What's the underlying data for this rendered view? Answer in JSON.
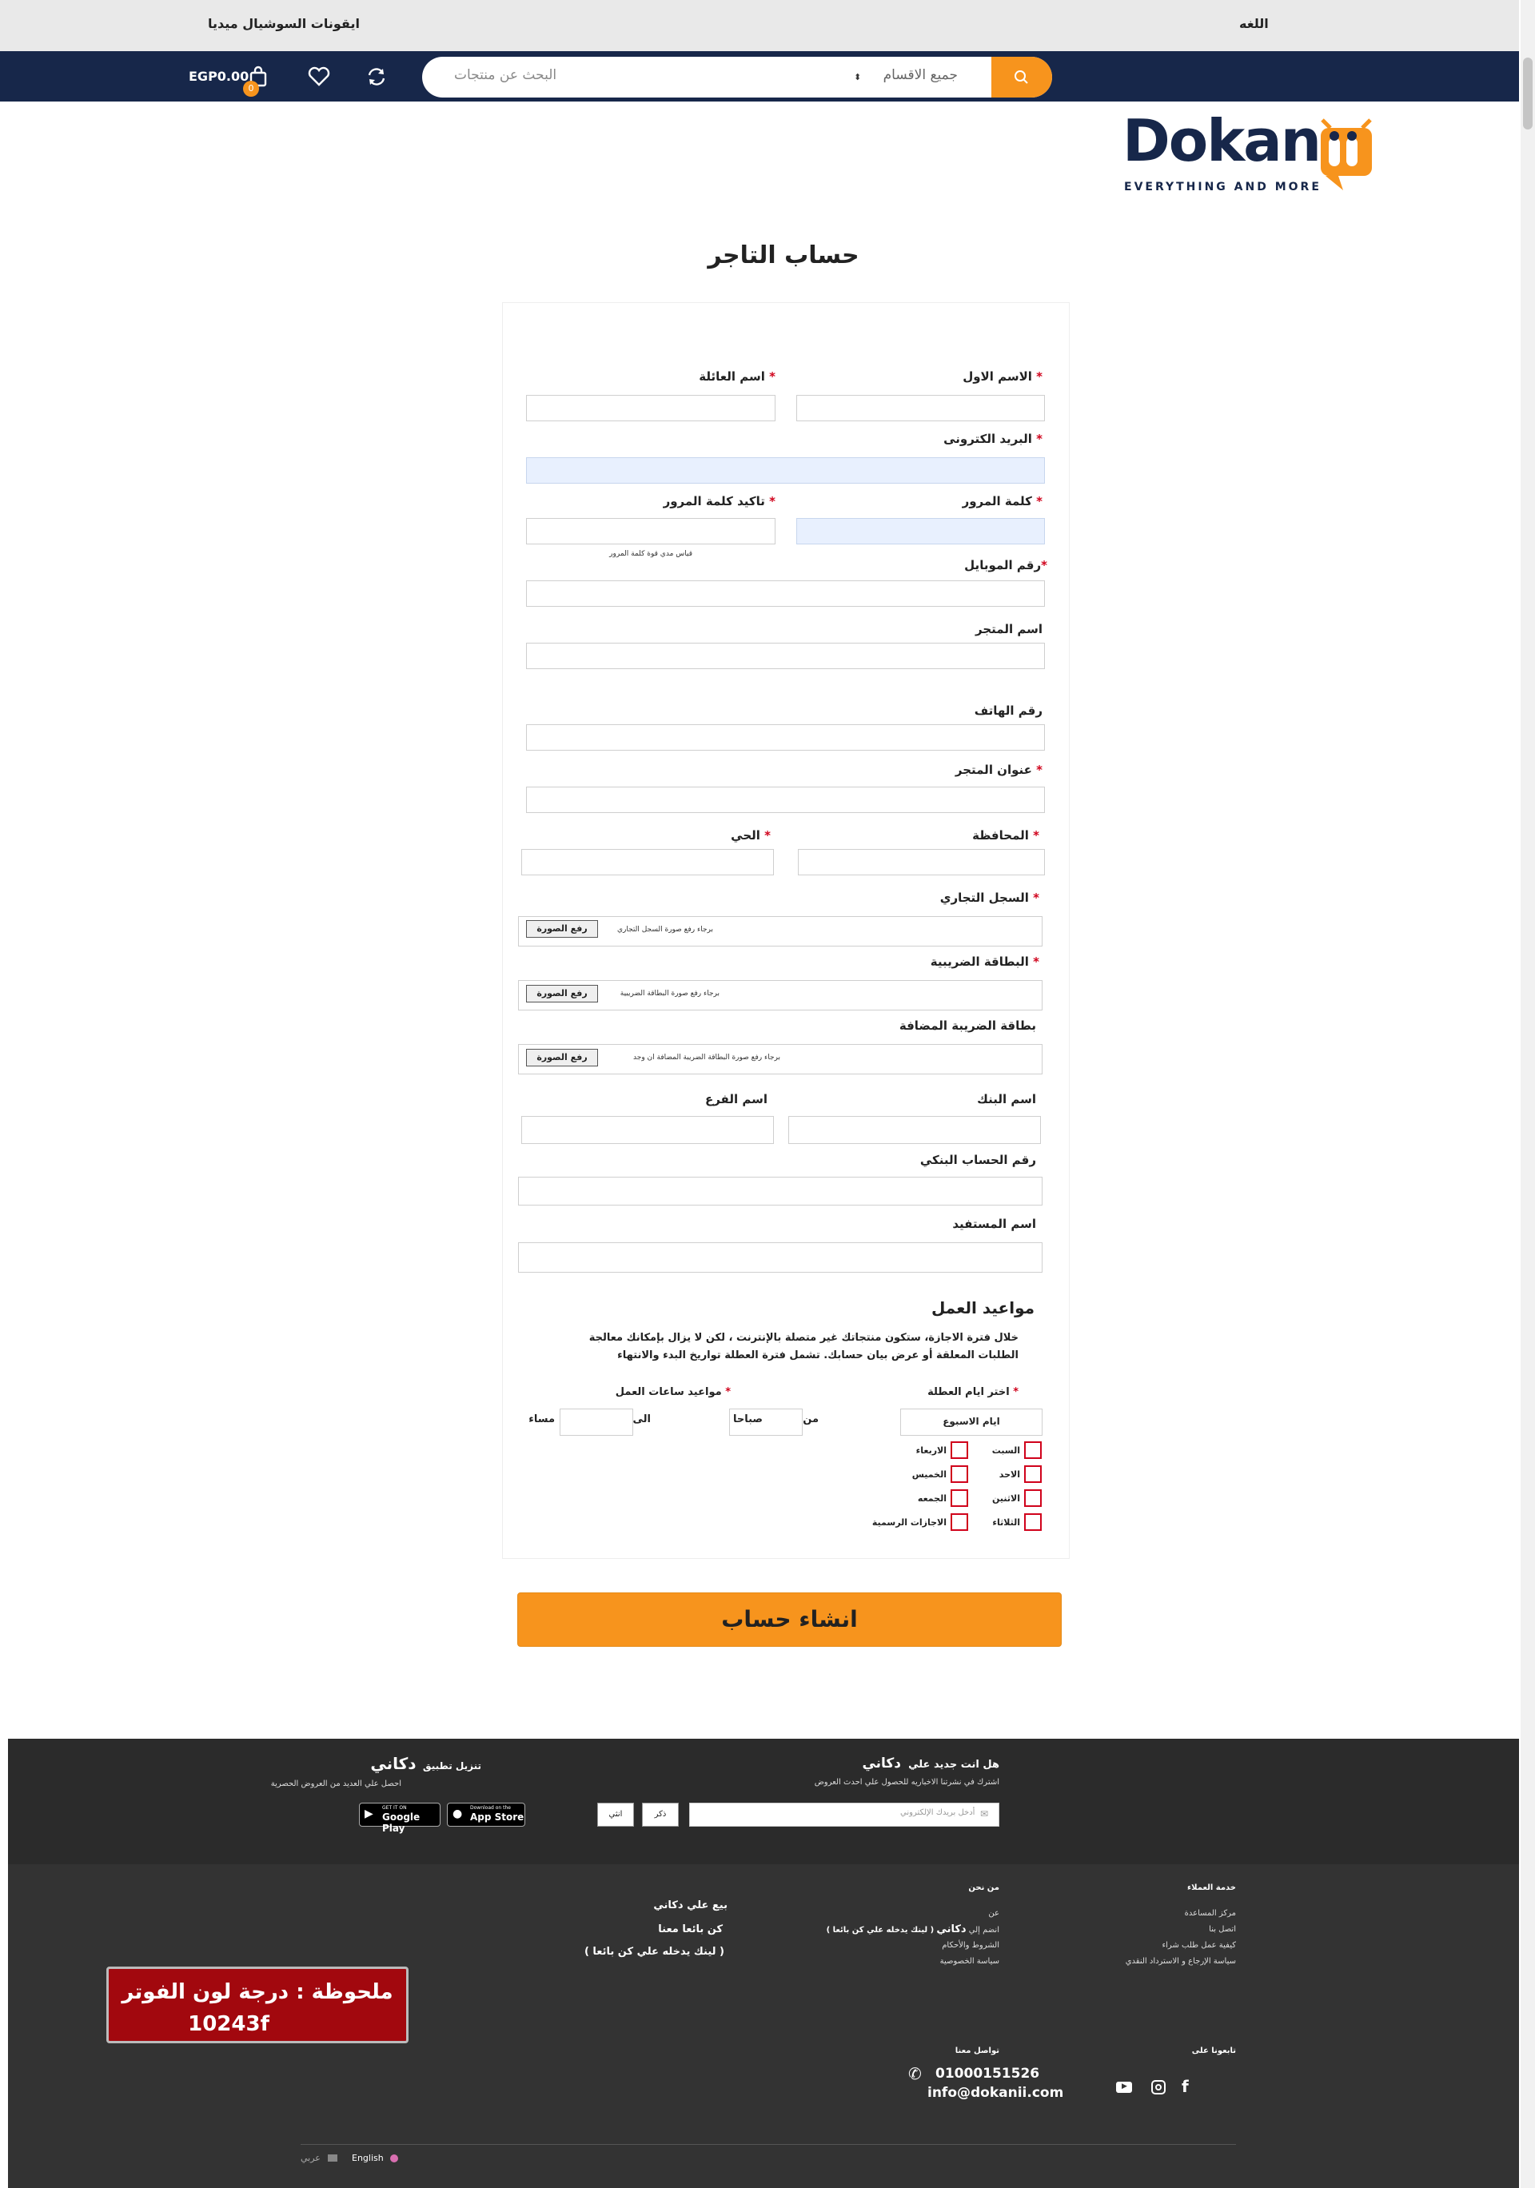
{
  "topbar": {
    "language_label": "اللغه",
    "social_label": "ايقونات السوشيال ميديا"
  },
  "header": {
    "search_placeholder": "البحث عن منتجات",
    "category_select": "جميع الاقسام",
    "cart_total": "EGP0.00",
    "cart_count": "0"
  },
  "logo": {
    "brand": "Dokan",
    "tagline": "EVERYTHING AND MORE"
  },
  "page_title": "حساب التاجر",
  "form": {
    "first_name": "الاسم الاول",
    "last_name": "اسم العائلة",
    "email": "البريد الكترونى",
    "password": "كلمة المرور",
    "confirm_password": "تاكيد كلمة المرور",
    "password_strength": "قياس مدي قوة كلمة المرور",
    "mobile": "رقم الموبايل",
    "store_name": "اسم المتجر",
    "phone": "رقم الهاتف",
    "store_address": "عنوان المتجر",
    "governorate": "المحافظة",
    "district": "الحي",
    "commercial_register": "السجل التجاري",
    "commercial_register_hint": "برجاء رفع صورة السجل التجاري",
    "tax_card": "البطاقة الضريبية",
    "tax_card_hint": "برجاء رفع صورة البطاقة الضريبية",
    "vat_card": "بطاقة الضريبة المضافة",
    "vat_card_hint": "برجاء رفع صورة البطاقة الضريبة المضافة ان وجد",
    "upload_button": "رفع الصورة",
    "bank_name": "اسم البنك",
    "branch_name": "اسم الفرع",
    "bank_account": "رقم الحساب البنكي",
    "beneficiary": "اسم المستفيد",
    "star": "*"
  },
  "working_hours": {
    "title": "مواعيد العمل",
    "description_1": "خلال فترة الاجازة، ستكون منتجاتك غير متصلة بالإنترنت ، لكن لا يزال بإمكانك معالجة",
    "description_2": "الطلبات المعلقة أو عرض بيان حسابك. تشمل فترة العطلة تواريخ البدء والانتهاء",
    "holidays_label": "اختر ايام العطلة",
    "hours_label": "مواعيد ساعات العمل",
    "weekdays_select": "ايام الاسبوع",
    "from": "من",
    "am": "صباحا",
    "to": "الى",
    "pm": "مساء",
    "days_right": [
      "السبت",
      "الاحد",
      "الاثنين",
      "الثلاثاء"
    ],
    "days_left": [
      "الاربعاء",
      "الخميس",
      "الجمعه",
      "الاجازات الرسمية"
    ]
  },
  "submit_button": "انشاء حساب",
  "footer": {
    "newsletter_title": "هل انت جديد علي",
    "newsletter_brand": "دكاني",
    "newsletter_sub": "اشترك في نشرتنا الاخباريه للحصول علي احدث العروض",
    "email_placeholder": "أدخل بريدك الإلكتروني",
    "male_button": "ذكر",
    "female_button": "انثي",
    "app_title": "تنزيل تطبيق",
    "app_brand": "دكاني",
    "app_sub": "احصل علي العديد من العروض الحصرية",
    "app_store_small": "Download on the",
    "app_store": "App Store",
    "google_play_small": "GET IT ON",
    "google_play": "Google Play",
    "customer_service_title": "خدمة العملاء",
    "customer_service_links": [
      "مركز المساعدة",
      "اتصل بنا",
      "كيفية عمل طلب شراء",
      "سياسة الإرجاع و الاسترداد النقدي"
    ],
    "about_title": "من نحن",
    "about_links": [
      "عن",
      "انضم إلي",
      "الشروط والأحكام",
      "سياسة الخصوصية"
    ],
    "about_join_brand": "دكاني",
    "about_join_note": "( لينك يدخله علي كن بائعا )",
    "sell_title": "بيع علي دكاني",
    "sell_link": "كن بائعا معنا",
    "sell_note": "( لينك يدخله علي كن بائعا )",
    "note_line1": "ملحوظة : درجة لون الفوتر",
    "note_line2": "10243f",
    "follow_title": "تابعونا على",
    "contact_title": "تواصل معنا",
    "phone": "01000151526",
    "email": "info@dokanii.com",
    "lang_en": "English",
    "lang_ar": "عربي"
  },
  "colors": {
    "nav": "#17274a",
    "accent": "#f7941d",
    "footer": "#333333",
    "required": "#d0021b"
  }
}
